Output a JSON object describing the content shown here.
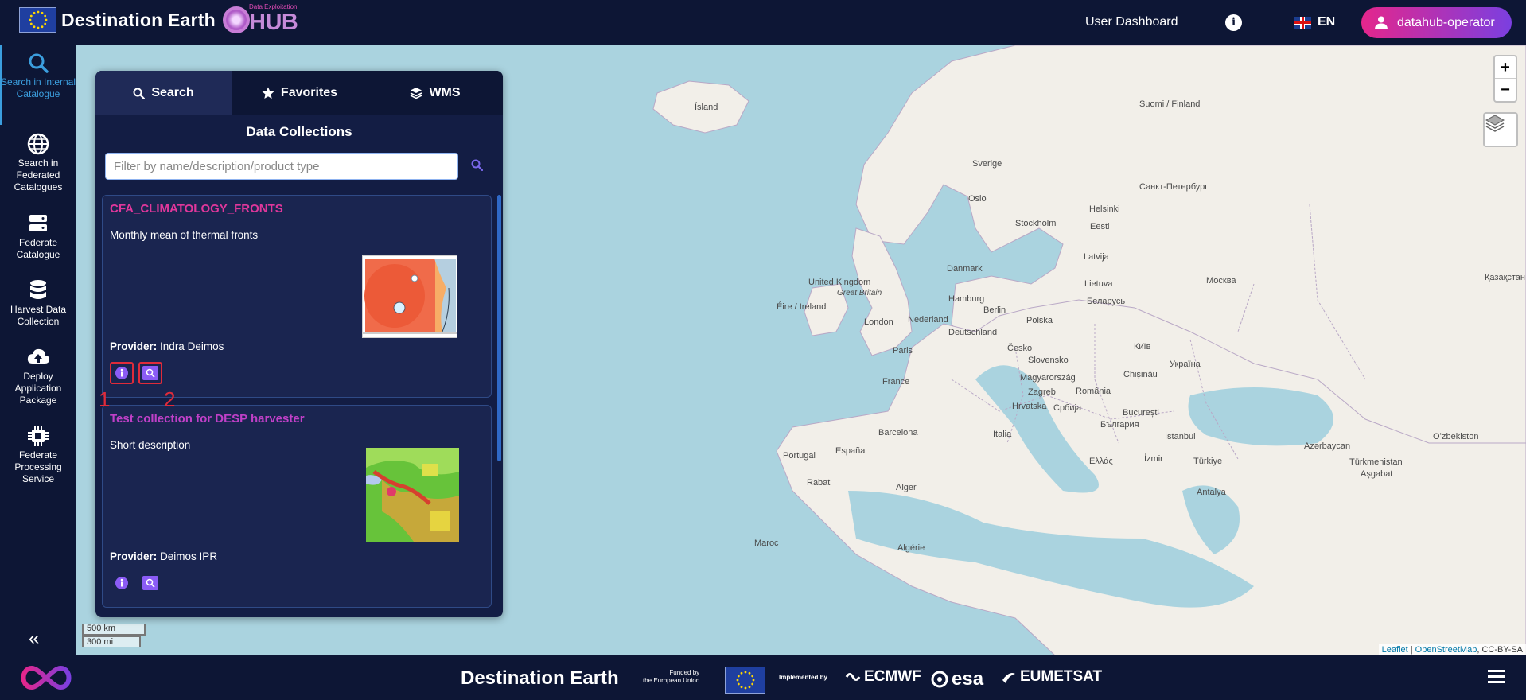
{
  "header": {
    "brand": "Destination Earth",
    "hub_sub": "Data Exploitation",
    "hub_text": "HUB",
    "user_dashboard": "User Dashboard",
    "language": "EN",
    "user": "datahub-operator"
  },
  "sidebar": {
    "items": [
      {
        "label": "Search in Internal Catalogue",
        "icon": "search-icon",
        "active": true
      },
      {
        "label": "Search in Federated Catalogues",
        "icon": "globe-icon"
      },
      {
        "label": "Federate Catalogue",
        "icon": "server-icon"
      },
      {
        "label": "Harvest Data Collection",
        "icon": "database-icon"
      },
      {
        "label": "Deploy Application Package",
        "icon": "cloud-upload-icon"
      },
      {
        "label": "Federate Processing Service",
        "icon": "chip-icon"
      }
    ],
    "collapse": "«"
  },
  "panel": {
    "tabs": [
      {
        "label": "Search",
        "icon": "search-icon",
        "active": true
      },
      {
        "label": "Favorites",
        "icon": "star-icon"
      },
      {
        "label": "WMS",
        "icon": "layers-icon"
      }
    ],
    "title": "Data Collections",
    "filter_placeholder": "Filter by name/description/product type",
    "provider_label": "Provider:",
    "collections": [
      {
        "title": "CFA_CLIMATOLOGY_FRONTS",
        "description": "Monthly mean of thermal fronts",
        "provider": "Indra Deimos"
      },
      {
        "title": "Test collection for DESP harvester",
        "description": "Short description",
        "provider": "Deimos IPR"
      }
    ],
    "annotations": [
      "1",
      "2"
    ]
  },
  "map": {
    "zoom_in": "+",
    "zoom_out": "−",
    "scale_km": "500 km",
    "scale_mi": "300 mi",
    "attribution_leaflet": "Leaflet",
    "attribution_sep": " | ",
    "attribution_osm": "OpenStreetMap",
    "attribution_license": ", CC-BY-SA",
    "labels": [
      "Ísland",
      "Suomi / Finland",
      "Sverige",
      "Oslo",
      "Stockholm",
      "Helsinki",
      "Санкт-Петербург",
      "Eesti",
      "Latvija",
      "Lietuva",
      "Danmark",
      "United Kingdom",
      "Great Britain",
      "Éire / Ireland",
      "London",
      "Hamburg",
      "Berlin",
      "Nederland",
      "Deutschland",
      "Polska",
      "Беларусь",
      "Москва",
      "Paris",
      "Česko",
      "Slovensko",
      "Київ",
      "Україна",
      "Chișinău",
      "France",
      "Magyarország",
      "Zagreb",
      "România",
      "Hrvatska",
      "Србија",
      "București",
      "България",
      "Barcelona",
      "Italia",
      "España",
      "Portugal",
      "İstanbul",
      "Ελλάς",
      "İzmir",
      "Türkiye",
      "Antalya",
      "Azərbaycan",
      "Rabat",
      "Alger",
      "Algérie",
      "Maroc",
      "Қазақстан",
      "Türkmenistan",
      "Aşgabat",
      "Oʻzbekiston"
    ]
  },
  "footer": {
    "brand": "Destination Earth",
    "funded_line1": "Funded by",
    "funded_line2": "the European Union",
    "implemented": "Implemented by",
    "partners": [
      "ECMWF",
      "esa",
      "EUMETSAT"
    ]
  }
}
